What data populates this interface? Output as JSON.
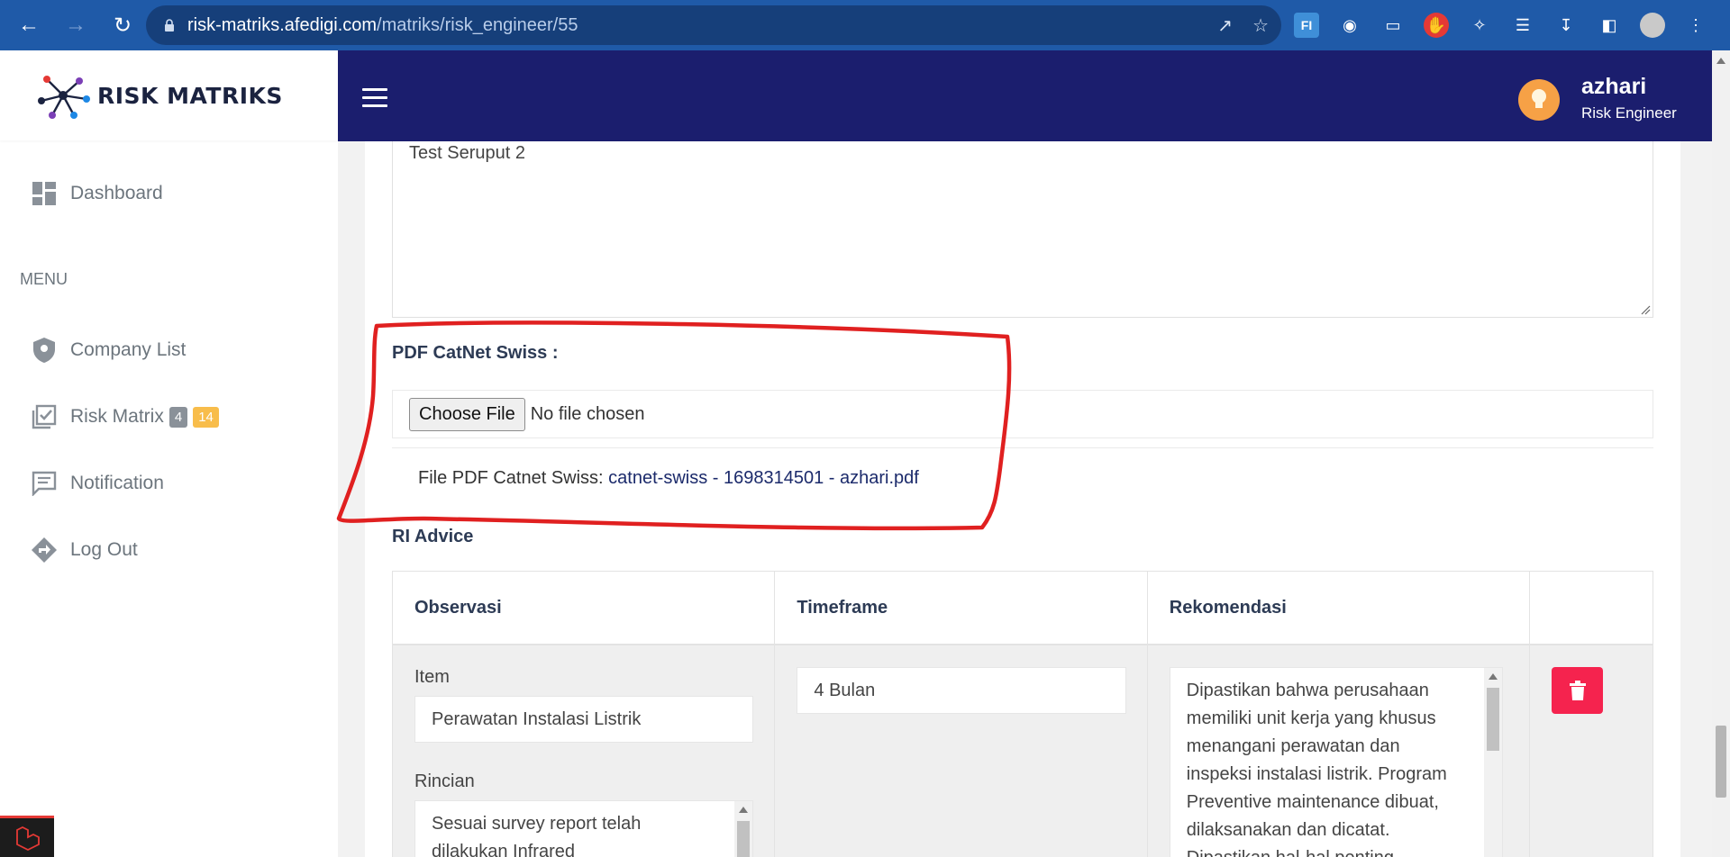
{
  "browser": {
    "url_host": "risk-matriks.afedigi.com",
    "url_path": "/matriks/risk_engineer/55"
  },
  "sidebar": {
    "brand": "RISK MATRIKS",
    "dashboard": "Dashboard",
    "menu_label": "MENU",
    "items": [
      {
        "label": "Company List"
      },
      {
        "label": "Risk Matrix",
        "badge_grey": "4",
        "badge_amber": "14"
      },
      {
        "label": "Notification"
      },
      {
        "label": "Log Out"
      }
    ]
  },
  "header": {
    "user_name": "azhari",
    "user_role": "Risk Engineer"
  },
  "form": {
    "textarea_value": "Test Seruput 2",
    "pdf_label": "PDF CatNet Swiss :",
    "choose_file": "Choose File",
    "no_file": "No file chosen",
    "file_info_prefix": "File PDF Catnet Swiss: ",
    "file_name": "catnet-swiss - 1698314501 - azhari.pdf",
    "ri_advice_label": "RI Advice"
  },
  "table": {
    "headers": [
      "Observasi",
      "Timeframe",
      "Rekomendasi",
      ""
    ],
    "row": {
      "item_label": "Item",
      "item_value": "Perawatan Instalasi Listrik",
      "rincian_label": "Rincian",
      "rincian_value": "Sesuai survey report telah dilakukan Infrared",
      "timeframe": "4 Bulan",
      "rekomendasi": "Dipastikan bahwa perusahaan memiliki unit kerja yang khusus menangani perawatan dan inspeksi instalasi listrik. Program Preventive maintenance dibuat, dilaksanakan dan dicatat. Dipastikan hal-hal penting"
    }
  },
  "colors": {
    "header_bg": "#1b1e6e",
    "browser_bg": "#1f5aa8",
    "delete_btn": "#f5234e",
    "annotation": "#e02020"
  }
}
